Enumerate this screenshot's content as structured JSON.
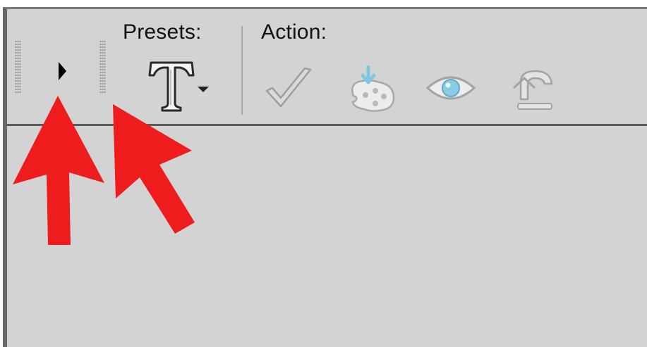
{
  "toolbar": {
    "presets_label": "Presets:",
    "action_label": "Action:"
  },
  "icons": {
    "expand": "expand-arrow-icon",
    "text_preset": "text-preset-icon",
    "apply": "checkmark-icon",
    "save_preset": "palette-save-icon",
    "preview": "eye-icon",
    "reset": "undo-icon"
  },
  "colors": {
    "panel_bg": "#d3d3d3",
    "annotation_arrow": "#ee1c1c",
    "icon_disabled": "#a9a9a9",
    "icon_accent": "#7fc6e0"
  }
}
